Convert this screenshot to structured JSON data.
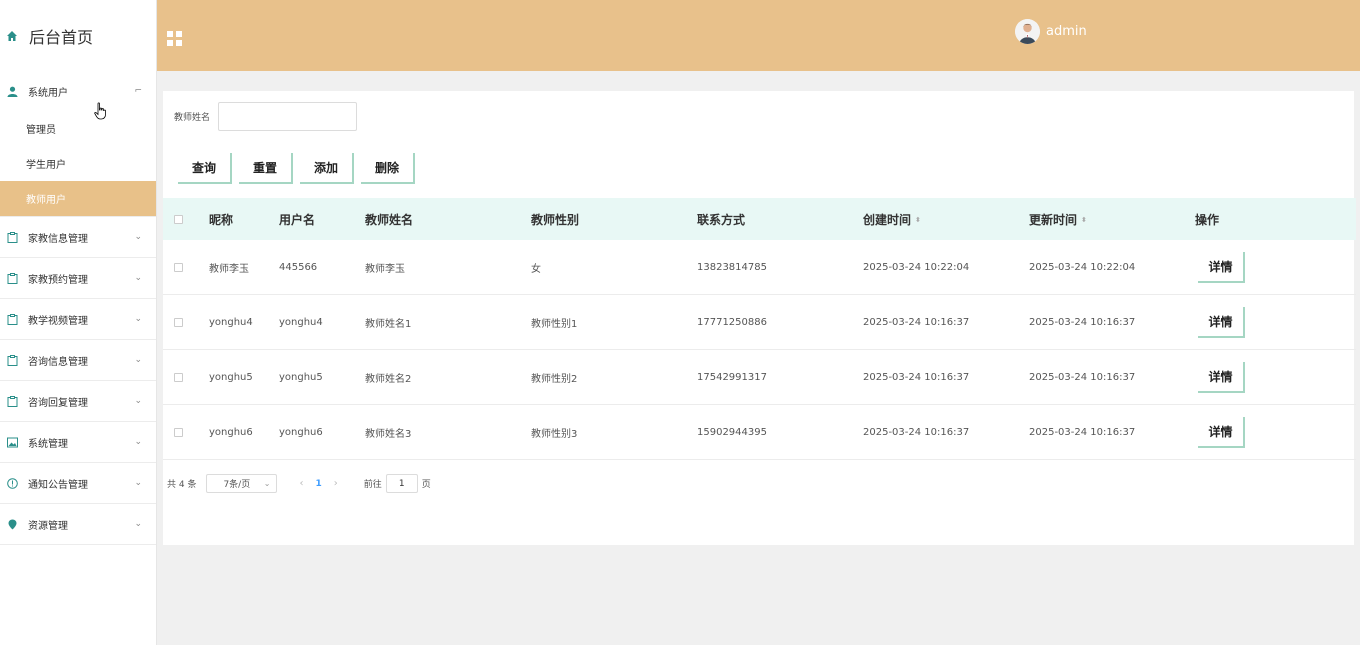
{
  "brand": {
    "title": "后台首页"
  },
  "sidebar": {
    "groups": [
      {
        "label": "系统用户",
        "icon": "user-icon",
        "expanded": true,
        "children": [
          "管理员",
          "学生用户",
          "教师用户"
        ],
        "active_child": "教师用户"
      },
      {
        "label": "家教信息管理",
        "icon": "clipboard-icon"
      },
      {
        "label": "家教预约管理",
        "icon": "clipboard-icon"
      },
      {
        "label": "教学视频管理",
        "icon": "clipboard-icon"
      },
      {
        "label": "咨询信息管理",
        "icon": "clipboard-icon"
      },
      {
        "label": "咨询回复管理",
        "icon": "clipboard-icon"
      },
      {
        "label": "系统管理",
        "icon": "picture-icon"
      },
      {
        "label": "通知公告管理",
        "icon": "info-circle-icon"
      },
      {
        "label": "资源管理",
        "icon": "location-pin-icon"
      }
    ]
  },
  "header": {
    "username": "admin"
  },
  "search": {
    "label": "教师姓名",
    "value": ""
  },
  "buttons": {
    "query": "查询",
    "reset": "重置",
    "add": "添加",
    "delete": "删除"
  },
  "table": {
    "columns": [
      "昵称",
      "用户名",
      "教师姓名",
      "教师性别",
      "联系方式",
      "创建时间",
      "更新时间",
      "操作"
    ],
    "rows": [
      {
        "nickname": "教师李玉",
        "username": "445566",
        "teacher_name": "教师李玉",
        "gender": "女",
        "phone": "13823814785",
        "created": "2025-03-24 10:22:04",
        "updated": "2025-03-24 10:22:04"
      },
      {
        "nickname": "yonghu4",
        "username": "yonghu4",
        "teacher_name": "教师姓名1",
        "gender": "教师性别1",
        "phone": "17771250886",
        "created": "2025-03-24 10:16:37",
        "updated": "2025-03-24 10:16:37"
      },
      {
        "nickname": "yonghu5",
        "username": "yonghu5",
        "teacher_name": "教师姓名2",
        "gender": "教师性别2",
        "phone": "17542991317",
        "created": "2025-03-24 10:16:37",
        "updated": "2025-03-24 10:16:37"
      },
      {
        "nickname": "yonghu6",
        "username": "yonghu6",
        "teacher_name": "教师姓名3",
        "gender": "教师性别3",
        "phone": "15902944395",
        "created": "2025-03-24 10:16:37",
        "updated": "2025-03-24 10:16:37"
      }
    ],
    "detail_label": "详情"
  },
  "pagination": {
    "total": "共 4 条",
    "page_size": "7条/页",
    "current": "1",
    "goto_prefix": "前往",
    "goto_value": "1",
    "goto_suffix": "页"
  },
  "colors": {
    "header": "#e8c18b",
    "active": "#e8c189",
    "accent": "#2a8f8a",
    "table_head": "#e8f8f5"
  }
}
